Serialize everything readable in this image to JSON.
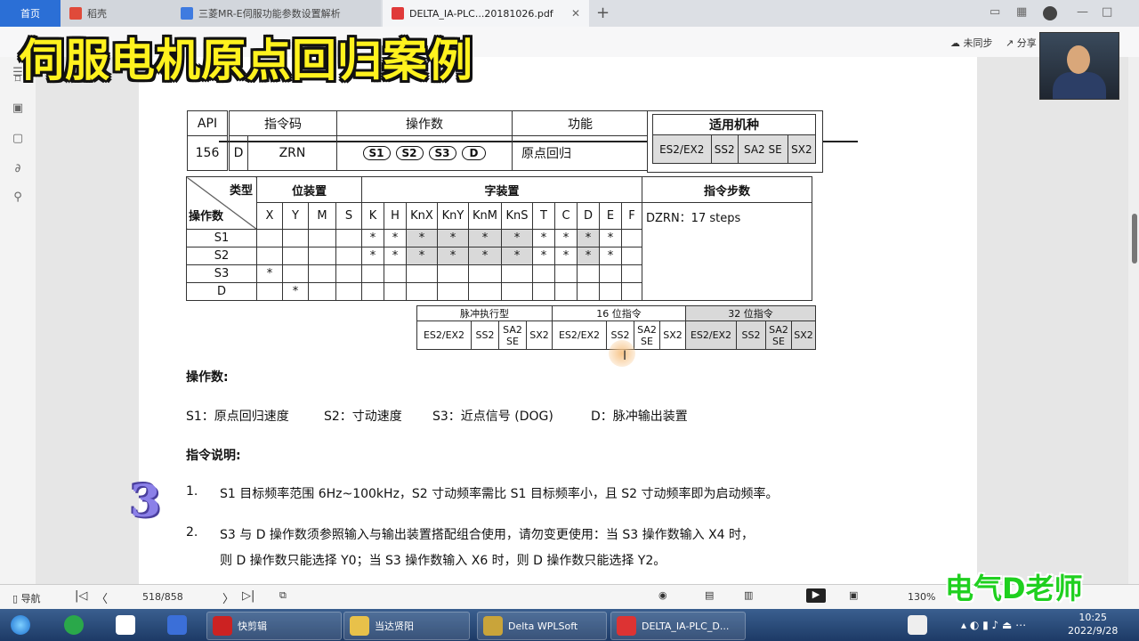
{
  "tabs": {
    "home": "首页",
    "tab1": "稻壳",
    "tab2": "三菱MR-E伺服功能参数设置解析",
    "tab3": "DELTA_IA-PLC...20181026.pdf"
  },
  "toolbar": {
    "sync": "未同步",
    "share": "分享"
  },
  "overlay_title": "伺服电机原点回归案例",
  "watermark": "电气D老师",
  "table_main": {
    "api_h": "API",
    "code_h": "指令码",
    "ops_h": "操作数",
    "func_h": "功能",
    "api": "156",
    "d": "D",
    "code": "ZRN",
    "ops": [
      "S1",
      "S2",
      "S3",
      "D"
    ],
    "func": "原点回归"
  },
  "models": {
    "title": "适用机种",
    "items": [
      "ES2/EX2",
      "SS2",
      "SA2 SE",
      "SX2"
    ]
  },
  "operand_table": {
    "type_label": "类型",
    "op_label": "操作数",
    "bit_label": "位装置",
    "word_label": "字装置",
    "steps_label": "指令步数",
    "bit_cols": [
      "X",
      "Y",
      "M",
      "S"
    ],
    "word_cols": [
      "K",
      "H",
      "KnX",
      "KnY",
      "KnM",
      "KnS",
      "T",
      "C",
      "D",
      "E",
      "F"
    ],
    "rows": [
      "S1",
      "S2",
      "S3",
      "D"
    ],
    "steps": "DZRN：17 steps",
    "mark": "*"
  },
  "exec_table": {
    "pulse": "脉冲执行型",
    "bit16": "16 位指令",
    "bit32": "32 位指令",
    "models": [
      "ES2/EX2",
      "SS2",
      "SA2 SE",
      "SX2"
    ]
  },
  "section_ops": "操作数:",
  "ops_desc": {
    "s1": "S1：原点回归速度",
    "s2": "S2：寸动速度",
    "s3": "S3：近点信号 (DOG)",
    "d": "D：脉冲输出装置"
  },
  "section_desc": "指令说明:",
  "desc": {
    "n1": "1.",
    "l1": "S1 目标频率范围 6Hz~100kHz，S2 寸动频率需比 S1 目标频率小，且 S2 寸动频率即为启动频率。",
    "n2": "2.",
    "l2a": "S3 与 D 操作数须参照输入与输出装置搭配组合使用，请勿变更使用：当 S3 操作数输入 X4 时，",
    "l2b": "则 D 操作数只能选择 Y0；当 S3 操作数输入 X6 时，则 D 操作数只能选择 Y2。"
  },
  "big_number": "3",
  "statusbar": {
    "nav": "导航",
    "page": "518/858",
    "zoom": "130%"
  },
  "taskbar": {
    "items": [
      "快剪辑",
      "当达贤阳",
      "Delta WPLSoft",
      "DELTA_IA-PLC_D..."
    ],
    "time": "10:25",
    "date": "2022/9/28"
  },
  "colors": {
    "overlay": "#fff21e",
    "watermark": "#1fd01f",
    "tab_active": "#2b6fd6",
    "taskbar": "#1d3a66"
  }
}
